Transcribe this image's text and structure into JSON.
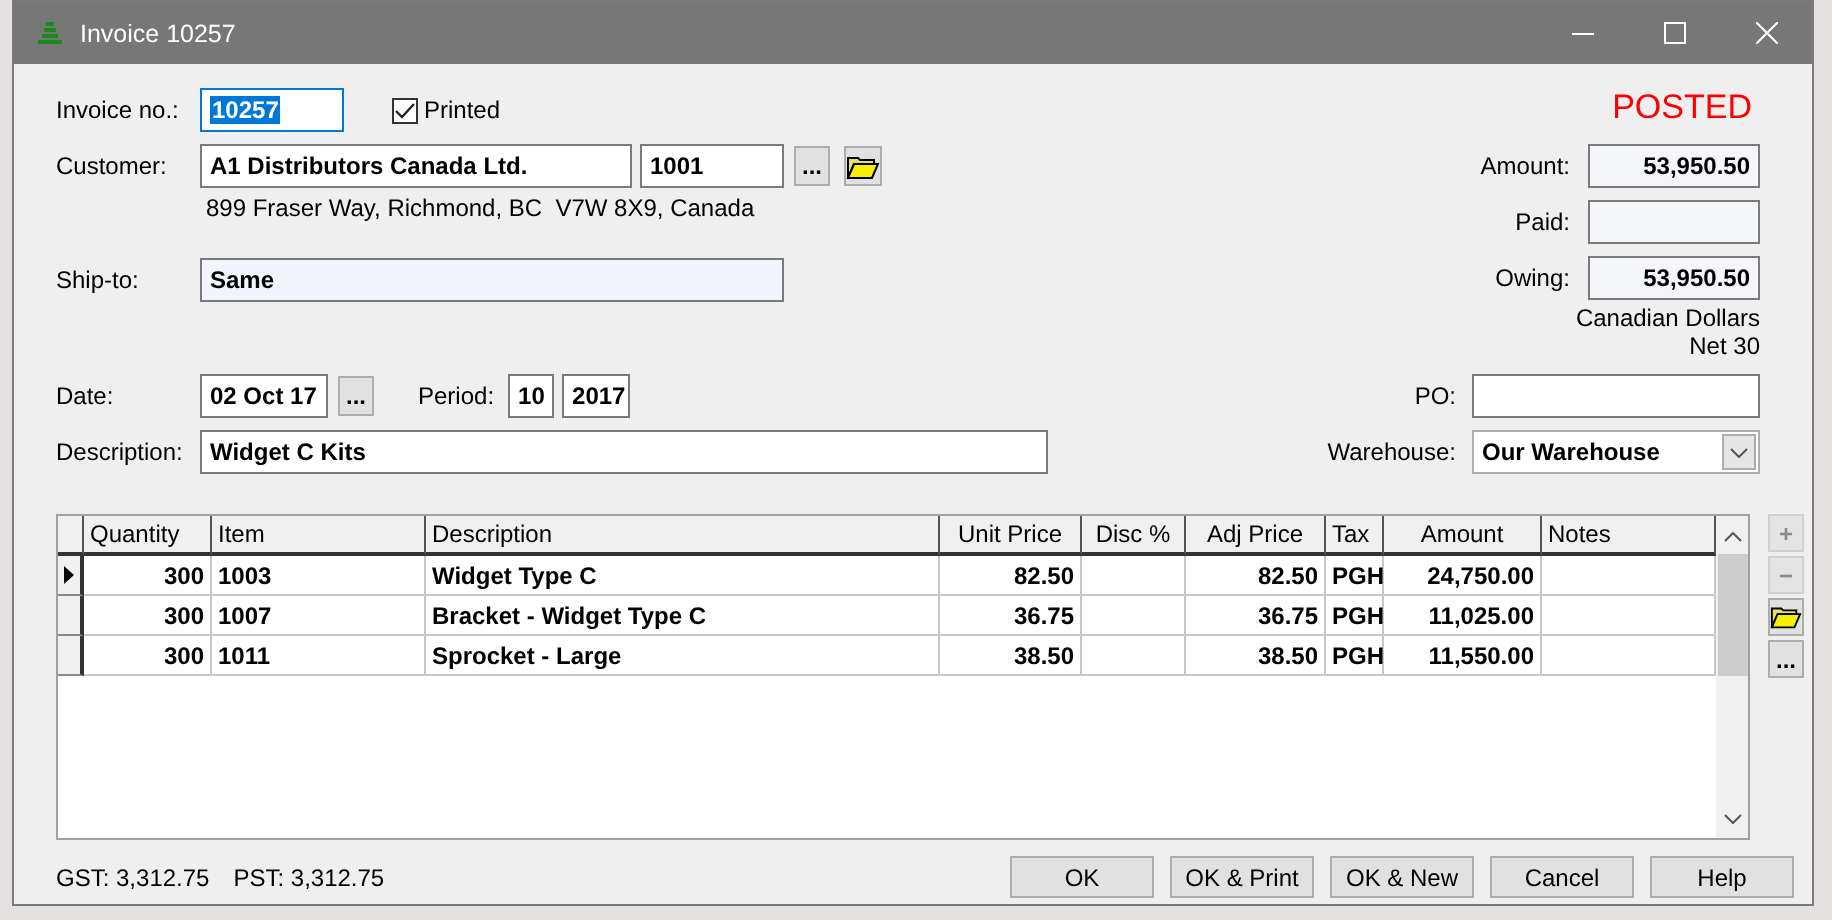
{
  "window": {
    "title": "Invoice 10257"
  },
  "invoice_no": {
    "label": "Invoice no.:",
    "value": "10257",
    "selected": true
  },
  "printed": {
    "label": "Printed",
    "checked": true
  },
  "status": "POSTED",
  "customer": {
    "label": "Customer:",
    "name": "A1 Distributors Canada Ltd.",
    "code": "1001",
    "browse": "...",
    "address": "899 Fraser Way, Richmond, BC  V7W 8X9, Canada"
  },
  "ship_to": {
    "label": "Ship-to:",
    "value": "Same"
  },
  "totals": [
    {
      "label": "Amount:",
      "value": "53,950.50"
    },
    {
      "label": "Paid:"
    },
    {
      "label": "Owing:",
      "value": "53,950.50"
    }
  ],
  "currency": "Canadian Dollars",
  "terms": "Net 30",
  "date": {
    "label": "Date:",
    "value": "02 Oct 17",
    "browse": "..."
  },
  "period": {
    "label": "Period:",
    "month": "10",
    "year": "2017"
  },
  "po": {
    "label": "PO:"
  },
  "description": {
    "label": "Description:",
    "value": "Widget C Kits"
  },
  "warehouse": {
    "label": "Warehouse:",
    "value": "Our Warehouse"
  },
  "table": {
    "columns": [
      "Quantity",
      "Item",
      "Description",
      "Unit Price",
      "Disc %",
      "Adj Price",
      "Tax",
      "Amount",
      "Notes"
    ],
    "rows": [
      {
        "selected": true,
        "cells": [
          "300",
          "1003",
          "Widget Type C",
          "82.50",
          "",
          "82.50",
          "PGH",
          "24,750.00",
          ""
        ]
      },
      {
        "selected": false,
        "cells": [
          "300",
          "1007",
          "Bracket - Widget Type C",
          "36.75",
          "",
          "36.75",
          "PGH",
          "11,025.00",
          ""
        ]
      },
      {
        "selected": false,
        "cells": [
          "300",
          "1011",
          "Sprocket - Large",
          "38.50",
          "",
          "38.50",
          "PGH",
          "11,550.00",
          ""
        ]
      }
    ]
  },
  "side_buttons": [
    {
      "kind": "text",
      "label": "+",
      "disabled": true
    },
    {
      "kind": "text",
      "label": "−",
      "disabled": true
    },
    {
      "kind": "folder",
      "disabled": false
    },
    {
      "kind": "text",
      "label": "...",
      "disabled": false
    }
  ],
  "taxes": [
    "GST: 3,312.75",
    "PST: 3,312.75"
  ],
  "buttons": [
    "OK",
    "OK & Print",
    "OK & New",
    "Cancel",
    "Help"
  ]
}
